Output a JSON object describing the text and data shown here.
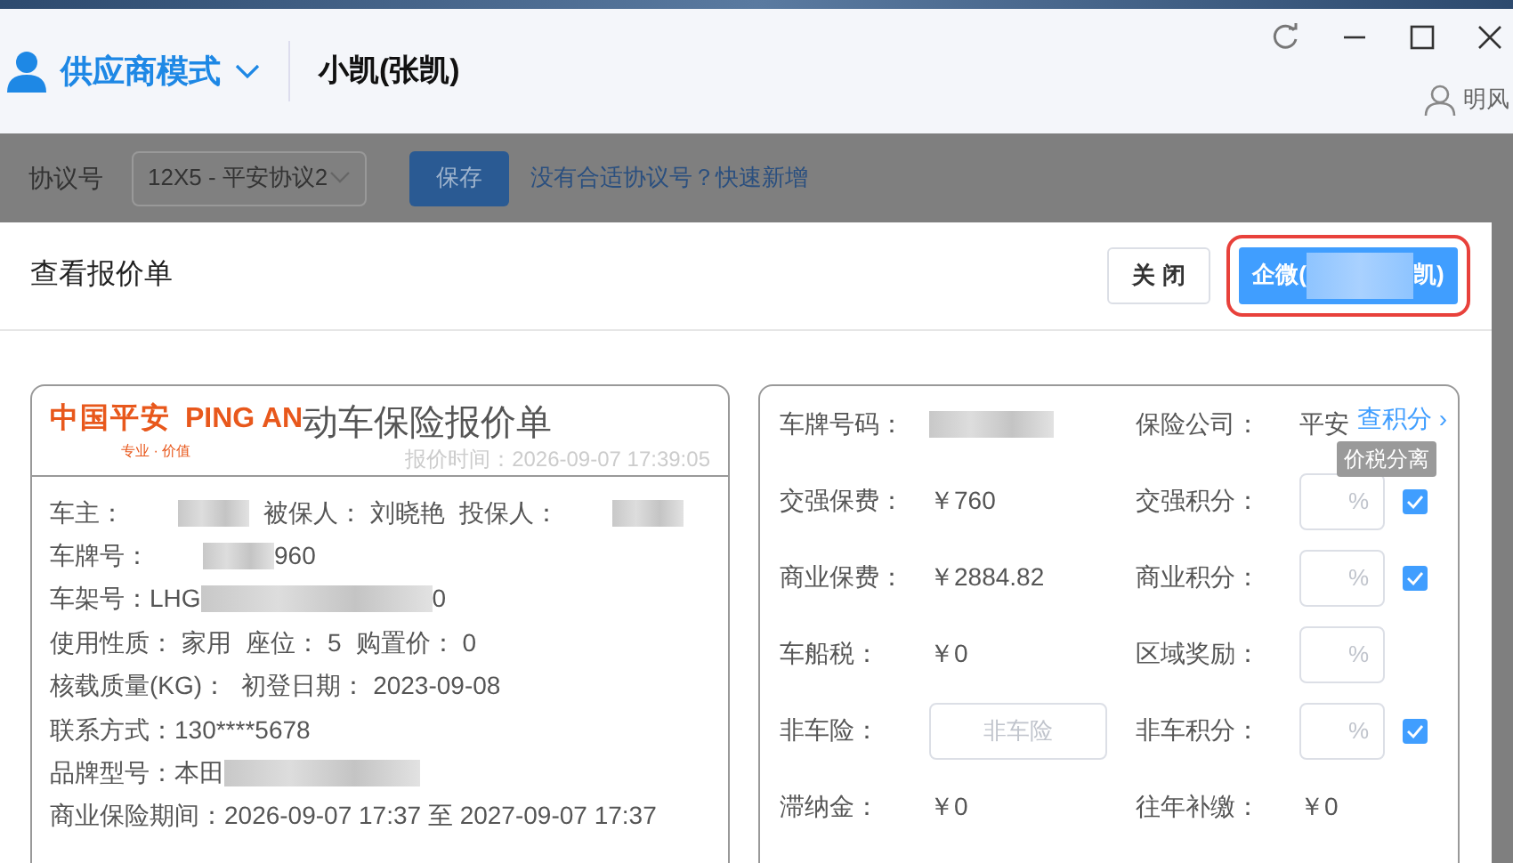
{
  "header": {
    "mode": "供应商模式",
    "user": "小凯(张凯)",
    "account": "明风"
  },
  "toolbar": {
    "label": "协议号",
    "select_value": "12X5 - 平安协议2",
    "save_button": "保存",
    "link": "没有合适协议号？快速新增"
  },
  "modal": {
    "title": "查看报价单",
    "buttons": [
      {
        "kind": "default",
        "label": "关 闭"
      },
      {
        "kind": "primary",
        "label_start": "企微(",
        "label_end": "凯)",
        "redacted": true,
        "highlighted": true
      }
    ]
  },
  "quote": {
    "logo_cn": "中国平安",
    "logo_en": "PING AN",
    "slogan": "专业 · 价值",
    "title": "动车保险报价单",
    "time": "报价时间：2026-09-07 17:39:05",
    "rows": [
      [
        {
          "label": "车主：",
          "redacted": true
        },
        {
          "label": "被保人：",
          "value": "刘晓艳"
        },
        {
          "label": "投保人：",
          "redacted": true
        }
      ],
      [
        {
          "label": "车牌号：",
          "redacted": true,
          "value": "960"
        }
      ],
      [
        {
          "label": "车架号：",
          "prefix": "LHG",
          "redacted": true,
          "value": "0"
        }
      ],
      [
        {
          "label": "使用性质：",
          "value": "家用"
        },
        {
          "label": "座位：",
          "value": "5"
        },
        {
          "label": "购置价：",
          "value": "0"
        }
      ],
      [
        {
          "label": "核载质量(KG)："
        },
        {
          "label": "初登日期：",
          "value": "2023-09-08"
        }
      ],
      [
        {
          "label": "联系方式：",
          "value": "130****5678"
        }
      ],
      [
        {
          "label": "品牌型号：",
          "prefix": "本田",
          "redacted": true
        }
      ],
      [
        {
          "label": "商业保险期间：",
          "value": "2026-09-07 17:37 至 2027-09-07 17:37"
        }
      ]
    ]
  },
  "points": {
    "link": "查积分 ›",
    "tooltip": "价税分离",
    "rows": [
      [
        {
          "kind": "text",
          "label": "车牌号码：",
          "redacted": true
        },
        {
          "kind": "text",
          "label": "保险公司：",
          "value": "平安"
        }
      ],
      [
        {
          "kind": "text",
          "label": "交强保费：",
          "value": "￥760"
        },
        {
          "kind": "percent",
          "label": "交强积分：",
          "placeholder": "%",
          "checked": true
        }
      ],
      [
        {
          "kind": "text",
          "label": "商业保费：",
          "value": "￥2884.82"
        },
        {
          "kind": "percent",
          "label": "商业积分：",
          "placeholder": "%",
          "checked": true
        }
      ],
      [
        {
          "kind": "text",
          "label": "车船税：",
          "value": "￥0"
        },
        {
          "kind": "percent",
          "label": "区域奖励：",
          "placeholder": "%"
        }
      ],
      [
        {
          "kind": "input",
          "label": "非车险：",
          "placeholder": "非车险"
        },
        {
          "kind": "percent",
          "label": "非车积分：",
          "placeholder": "%",
          "checked": true
        }
      ],
      [
        {
          "kind": "text",
          "label": "滞纳金：",
          "value": "￥0"
        },
        {
          "kind": "text",
          "label": "往年补缴：",
          "value": "￥0"
        }
      ]
    ]
  }
}
